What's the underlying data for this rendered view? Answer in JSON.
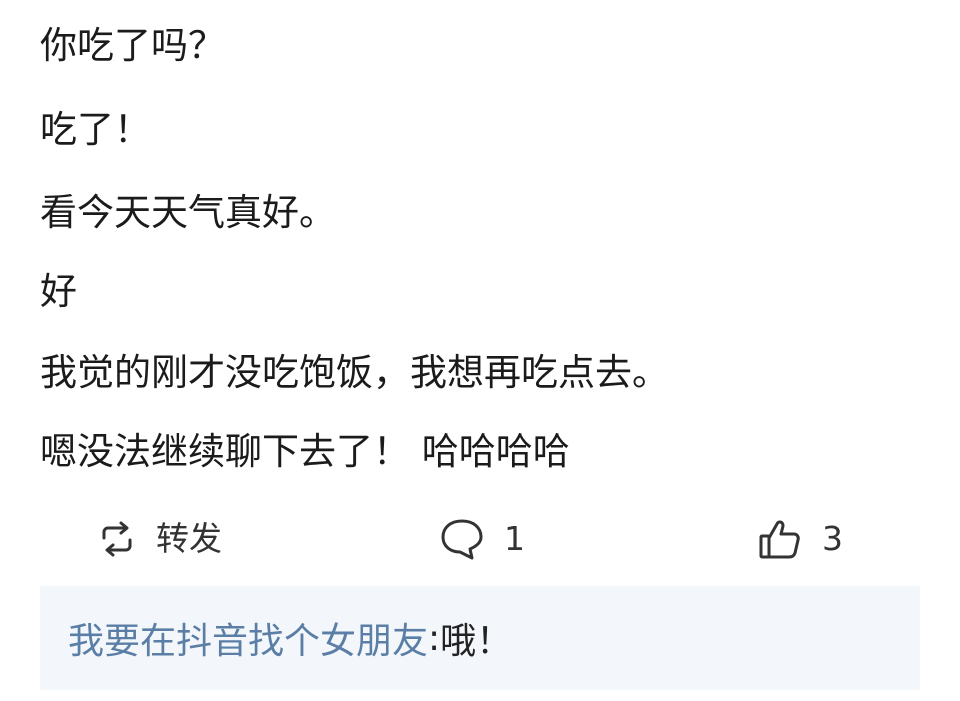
{
  "post": {
    "lines": [
      "你吃了吗？",
      "吃了！",
      "看今天天气真好。",
      "好",
      "我觉的刚才没吃饱饭，我想再吃点去。",
      "嗯没法继续聊下去了！ 哈哈哈哈"
    ]
  },
  "actions": {
    "repost": {
      "icon": "repost-icon",
      "label": "转发"
    },
    "comment": {
      "icon": "comment-icon",
      "count": "1"
    },
    "like": {
      "icon": "thumbs-up-icon",
      "count": "3"
    }
  },
  "reply": {
    "user": "我要在抖音找个女朋友",
    "separator": ":",
    "text": " 哦！"
  },
  "colors": {
    "reply_background": "#f3f6fa",
    "username": "#5b7ea6",
    "text": "#1b1b1b"
  }
}
